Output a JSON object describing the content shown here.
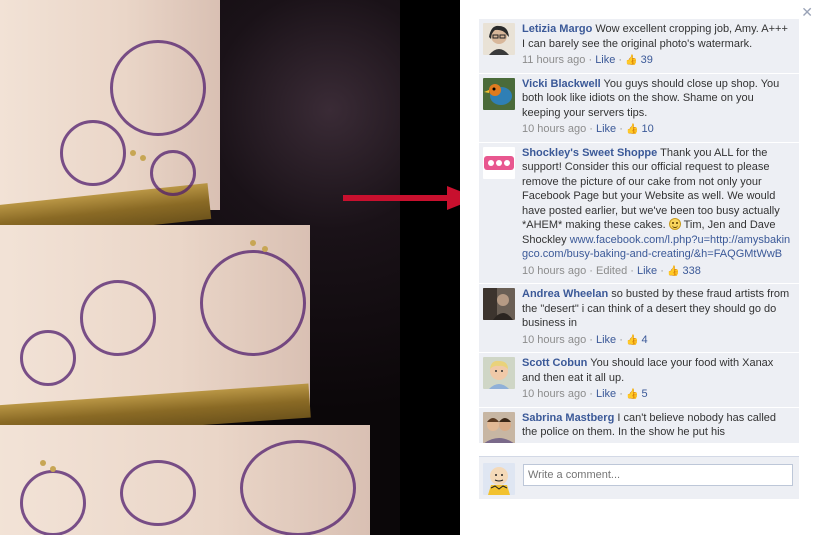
{
  "comments": [
    {
      "author": "Letizia Margo",
      "text": "Wow excellent cropping job, Amy. A+++ I can barely see the original photo's watermark.",
      "time": "11 hours ago",
      "like_label": "Like",
      "likes": "39",
      "avatar_icon": "woman-with-glasses-avatar"
    },
    {
      "author": "Vicki Blackwell",
      "text": "You guys should close up shop. You both look like idiots on the show. Shame on you keeping your servers tips.",
      "time": "10 hours ago",
      "like_label": "Like",
      "likes": "10",
      "avatar_icon": "bird-avatar"
    },
    {
      "author": "Shockley's Sweet Shoppe",
      "text": "Thank you ALL for the support! Consider this our official request to please remove the picture of our cake from not only your Facebook Page but your Website as well. We would have posted earlier, but we've been too busy actually *AHEM* making these cakes.",
      "text_after_emoji": "Tim, Jen and Dave Shockley",
      "link": "www.facebook.com/l.php?u=http://amysbakingco.com/busy-baking-and-creating/&h=FAQGMtWwB",
      "time": "10 hours ago",
      "edited": "Edited",
      "like_label": "Like",
      "likes": "338",
      "avatar_icon": "sweet-shoppe-logo-avatar"
    },
    {
      "author": "Andrea Wheelan",
      "text": "so busted by these fraud artists from the \"desert\" i can think of a desert they should go do business in",
      "time": "10 hours ago",
      "like_label": "Like",
      "likes": "4",
      "avatar_icon": "person-photo-avatar"
    },
    {
      "author": "Scott Cobun",
      "text": "You should lace your food with Xanax and then eat it all up.",
      "time": "10 hours ago",
      "like_label": "Like",
      "likes": "5",
      "avatar_icon": "child-photo-avatar"
    },
    {
      "author": "Sabrina Mastberg",
      "text": "I can't believe nobody has called the police on them. In the show he put his",
      "avatar_icon": "people-photo-avatar"
    }
  ],
  "compose": {
    "placeholder": "Write a comment...",
    "avatar_icon": "cartoon-character-avatar"
  },
  "colors": {
    "link": "#3b5998",
    "panel_bg": "#edeff4",
    "arrow": "#c8102e"
  }
}
